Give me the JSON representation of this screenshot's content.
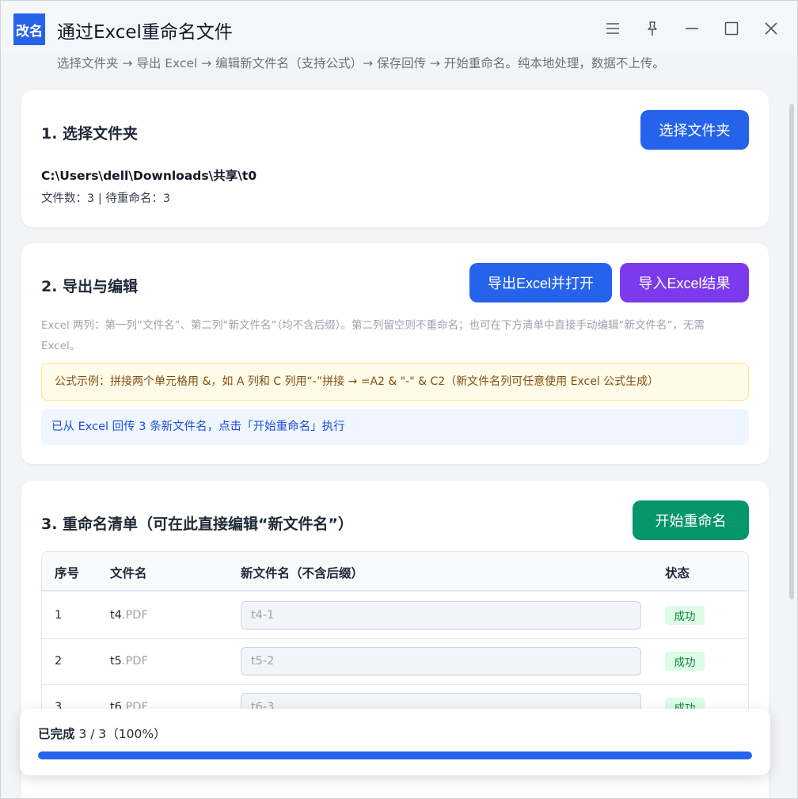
{
  "app": {
    "logo_text": "改名",
    "title": "通过Excel重命名文件",
    "subtitle": "选择文件夹 → 导出 Excel → 编辑新文件名（支持公式）→ 保存回传 → 开始重命名。纯本地处理，数据不上传。"
  },
  "window_controls": [
    "menu-icon",
    "pin-icon",
    "minimize-icon",
    "maximize-icon",
    "close-icon"
  ],
  "section1": {
    "title": "1. 选择文件夹",
    "choose_button": "选择文件夹",
    "path": "C:\\Users\\dell\\Downloads\\共享\\t0",
    "counts": "文件数：3 | 待重命名：3"
  },
  "section2": {
    "title": "2. 导出与编辑",
    "export_button": "导出Excel并打开",
    "import_button": "导入Excel结果",
    "note": "Excel 两列：第一列“文件名”、第二列“新文件名”（均不含后缀）。第二列留空则不重命名；也可在下方清单中直接手动编辑“新文件名”，无需 Excel。",
    "formula_tip": "公式示例：拼接两个单元格用 &，如 A 列和 C 列用“-”拼接 → =A2 & \"-\" & C2（新文件名列可任意使用 Excel 公式生成）",
    "info": "已从 Excel 回传 3 条新文件名，点击「开始重命名」执行"
  },
  "section3": {
    "title": "3. 重命名清单（可在此直接编辑“新文件名”）",
    "start_button": "开始重命名",
    "headers": {
      "index": "序号",
      "filename": "文件名",
      "newname": "新文件名（不含后缀）",
      "status": "状态"
    },
    "rows": [
      {
        "index": "1",
        "base": "t4",
        "ext": ".PDF",
        "newname": "t4-1",
        "status": "成功"
      },
      {
        "index": "2",
        "base": "t5",
        "ext": ".PDF",
        "newname": "t5-2",
        "status": "成功"
      },
      {
        "index": "3",
        "base": "t6",
        "ext": ".PDF",
        "newname": "t6-3",
        "status": "成功"
      }
    ]
  },
  "progress": {
    "label_prefix": "已完成",
    "label_value": "3 / 3（100%）",
    "percent": 100
  },
  "colors": {
    "primary": "#2563eb",
    "purple": "#7c3aed",
    "green": "#059669"
  }
}
